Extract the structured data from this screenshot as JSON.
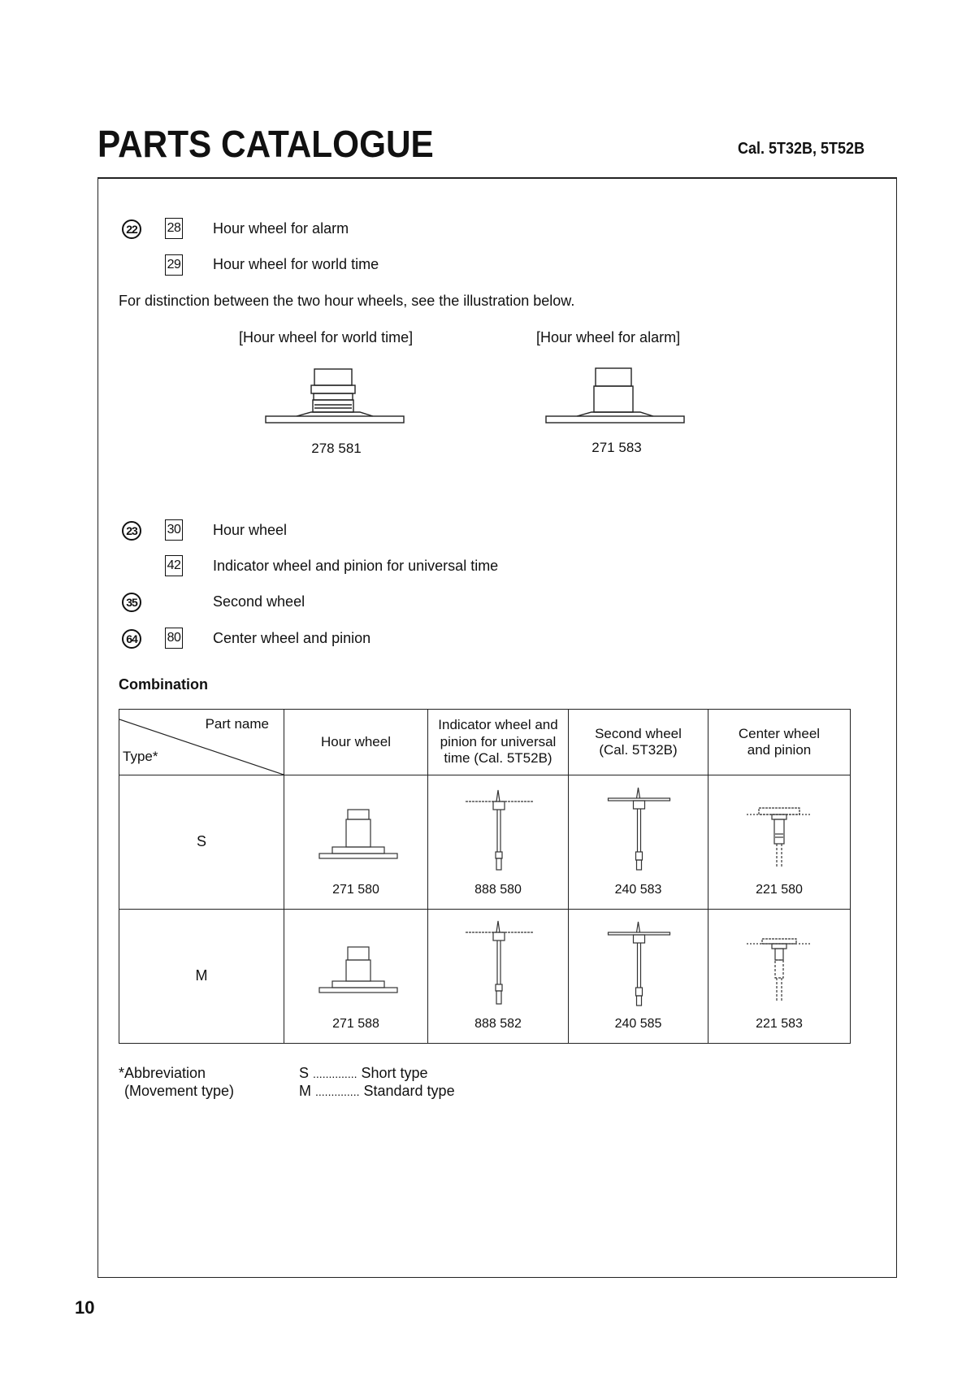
{
  "header": {
    "title": "PARTS CATALOGUE",
    "calibre": "Cal. 5T32B, 5T52B"
  },
  "section1": {
    "items": [
      {
        "circle": "22",
        "square": "28",
        "label": "Hour wheel for alarm"
      },
      {
        "circle": "",
        "square": "29",
        "label": "Hour wheel for world time"
      }
    ],
    "note": "For distinction between the two hour wheels, see the illustration below.",
    "illustrations": [
      {
        "caption": "[Hour wheel for world time]",
        "part_no": "278 581",
        "icon": "hour-wheel-world-time-drawing"
      },
      {
        "caption": "[Hour wheel for alarm]",
        "part_no": "271 583",
        "icon": "hour-wheel-alarm-drawing"
      }
    ]
  },
  "section2": {
    "items": [
      {
        "circle": "23",
        "square": "30",
        "label": "Hour wheel"
      },
      {
        "circle": "",
        "square": "42",
        "label": "Indicator wheel and pinion for universal time"
      },
      {
        "circle": "35",
        "square": "",
        "label": "Second wheel"
      },
      {
        "circle": "64",
        "square": "80",
        "label": "Center wheel and pinion"
      }
    ]
  },
  "combination": {
    "heading": "Combination",
    "corner": {
      "part_name": "Part name",
      "type": "Type*"
    },
    "columns": [
      {
        "label": "Hour wheel"
      },
      {
        "label": "Indicator wheel and pinion for universal time (Cal. 5T52B)"
      },
      {
        "label": "Second wheel (Cal. 5T32B)"
      },
      {
        "label": "Center wheel and pinion"
      }
    ],
    "rows": [
      {
        "type": "S",
        "parts": [
          "271 580",
          "888 580",
          "240 583",
          "221 580"
        ]
      },
      {
        "type": "M",
        "parts": [
          "271 588",
          "888 582",
          "240 585",
          "221 583"
        ]
      }
    ]
  },
  "abbreviation": {
    "title": "*Abbreviation",
    "subtitle": "(Movement type)",
    "entries": [
      {
        "key": "S",
        "dots": "..............",
        "value": "Short type"
      },
      {
        "key": "M",
        "dots": "..............",
        "value": "Standard type"
      }
    ]
  },
  "footer": {
    "page_number": "10"
  }
}
